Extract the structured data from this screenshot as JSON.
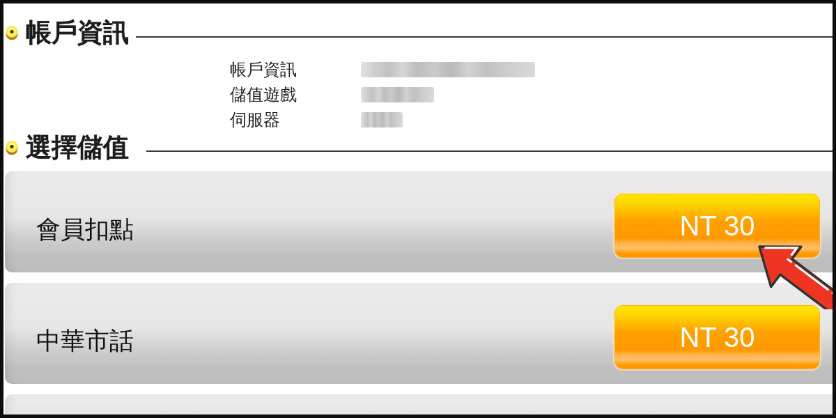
{
  "account_info": {
    "title": "帳戶資訊",
    "fields": [
      {
        "label": "帳戶資訊",
        "value_redacted": true
      },
      {
        "label": "儲值遊戲",
        "value_redacted": true
      },
      {
        "label": "伺服器",
        "value_redacted": true
      }
    ]
  },
  "top_up": {
    "title": "選擇儲值",
    "options": [
      {
        "label": "會員扣點",
        "price": "NT 30",
        "highlighted": true
      },
      {
        "label": "中華市話",
        "price": "NT 30",
        "highlighted": false
      }
    ]
  }
}
